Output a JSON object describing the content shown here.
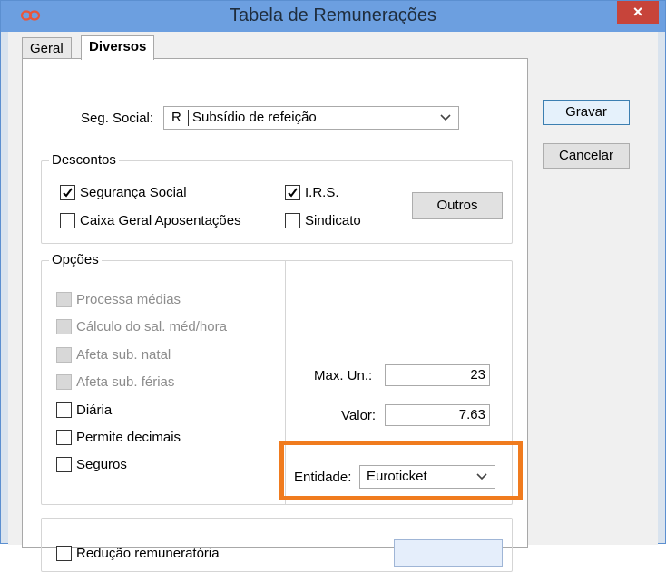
{
  "window": {
    "title": "Tabela de Remunerações",
    "close_glyph": "×"
  },
  "tabs": [
    {
      "label": "Geral",
      "active": false
    },
    {
      "label": "Diversos",
      "active": true
    }
  ],
  "seg_social": {
    "label": "Seg. Social:",
    "code": "R",
    "value": "Subsídio de refeição"
  },
  "descontos": {
    "legend": "Descontos",
    "items": [
      {
        "label": "Segurança Social",
        "checked": true
      },
      {
        "label": "Caixa Geral Aposentações",
        "checked": false
      },
      {
        "label": "I.R.S.",
        "checked": true
      },
      {
        "label": "Sindicato",
        "checked": false
      }
    ],
    "outros_label": "Outros"
  },
  "opcoes": {
    "legend": "Opções",
    "items": [
      {
        "label": "Processa médias",
        "checked": false,
        "disabled": true
      },
      {
        "label": "Cálculo do sal. méd/hora",
        "checked": false,
        "disabled": true
      },
      {
        "label": "Afeta sub. natal",
        "checked": false,
        "disabled": true
      },
      {
        "label": "Afeta sub. férias",
        "checked": false,
        "disabled": true
      },
      {
        "label": "Diária",
        "checked": false,
        "disabled": false
      },
      {
        "label": "Permite decimais",
        "checked": false,
        "disabled": false
      },
      {
        "label": "Seguros",
        "checked": false,
        "disabled": false
      }
    ],
    "max_un_label": "Max. Un.:",
    "max_un_value": "23",
    "valor_label": "Valor:",
    "valor_value": "7.63",
    "entidade_label": "Entidade:",
    "entidade_value": "Euroticket"
  },
  "reducao": {
    "label": "Redução remuneratória",
    "checked": false
  },
  "buttons": {
    "gravar": "Gravar",
    "cancelar": "Cancelar"
  },
  "colors": {
    "titlebar": "#6c9fe0",
    "close": "#c7443a",
    "highlight": "#f07b1e",
    "input_blue": "#e5eefb"
  },
  "icons": {
    "app": "infinity-logo-icon",
    "check": "checkmark-icon",
    "dropdown": "chevron-down-icon"
  }
}
